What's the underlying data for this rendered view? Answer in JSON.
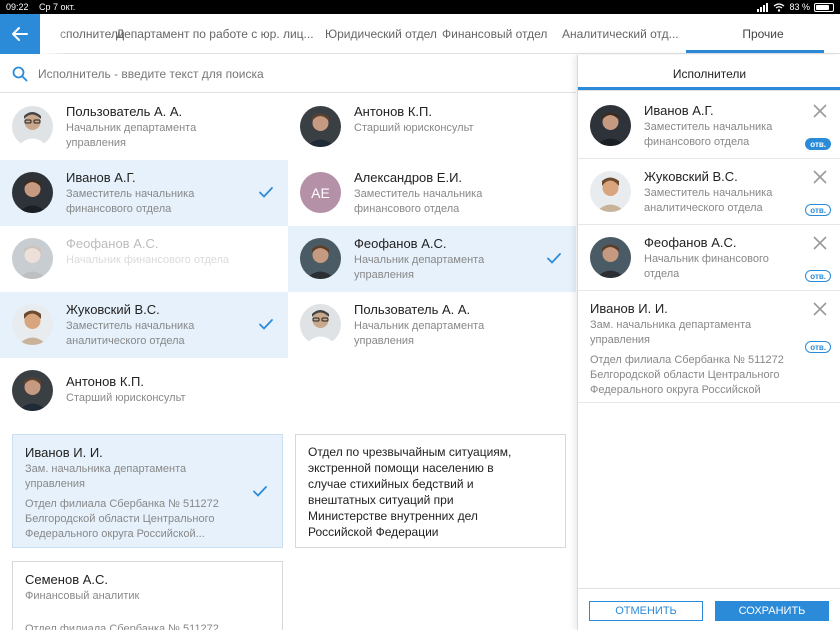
{
  "status_bar": {
    "time": "09:22",
    "date": "Ср 7 окт.",
    "battery": "83 %",
    "battery_level": 0.83
  },
  "tabs": {
    "items": [
      "сполнители",
      "Департамент по работе с юр. лиц...",
      "Юридический отдел",
      "Финансовый отдел",
      "Аналитический отд..."
    ],
    "active": "Прочие"
  },
  "search": {
    "placeholder": "Исполнитель - введите текст для поиска",
    "value": ""
  },
  "people": [
    {
      "name": "Пользователь А. А.",
      "role": "Начальник департамента управления",
      "selected": false,
      "disabled": false
    },
    {
      "name": "Антонов К.П.",
      "role": "Старший юрисконсульт",
      "selected": false,
      "disabled": false
    },
    {
      "name": "Иванов А.Г.",
      "role": "Заместитель начальника финансового отдела",
      "selected": true,
      "disabled": false
    },
    {
      "name": "Александров Е.И.",
      "role": "Заместитель начальника финансового отдела",
      "initials": "АЕ",
      "selected": false,
      "disabled": false
    },
    {
      "name": "Феофанов А.С.",
      "role": "Начальник финансового отдела",
      "selected": false,
      "disabled": true
    },
    {
      "name": "Феофанов А.С.",
      "role": "Начальник департамента управления",
      "selected": true,
      "disabled": false
    },
    {
      "name": "Жуковский В.С.",
      "role": "Заместитель начальника аналитического отдела",
      "selected": true,
      "disabled": false
    },
    {
      "name": "Пользователь А. А.",
      "role": "Начальник департамента управления",
      "selected": false,
      "disabled": false
    },
    {
      "name": "Антонов К.П.",
      "role": "Старший юрисконсульт",
      "selected": false,
      "disabled": false
    }
  ],
  "boxes": [
    {
      "name": "Иванов И. И.",
      "role": "Зам. начальника департамента управления",
      "org": "Отдел филиала Сбербанка № 511272 Белгородской области Центрального Федерального округа Российской...",
      "selected": true
    },
    {
      "text": "Отдел по чрезвычайным ситуациям, экстренной помощи населению в случае стихийных бедствий и внештатных ситуаций при Министерстве внутренних дел Российской Федерации"
    },
    {
      "name": "Семенов А.С.",
      "role": "Финансовый аналитик",
      "org": "Отдел филиала Сбербанка № 511272",
      "selected": false
    }
  ],
  "panel": {
    "title": "Исполнители",
    "items": [
      {
        "name": "Иванов А.Г.",
        "role": "Заместитель начальника финансового отдела",
        "badge": "отв.",
        "badge_filled": true
      },
      {
        "name": "Жуковский В.С.",
        "role": "Заместитель начальника аналитического отдела",
        "badge": "отв.",
        "badge_filled": false
      },
      {
        "name": "Феофанов А.С.",
        "role": "Начальник финансового отдела",
        "badge": "отв.",
        "badge_filled": false
      }
    ],
    "big_item": {
      "name": "Иванов И. И.",
      "role": "Зам. начальника департамента управления",
      "org": "Отдел филиала Сбербанка № 511272 Белгородской области Центрального Федерального округа Российской",
      "badge": "отв."
    },
    "cancel_label": "ОТМЕНИТЬ",
    "save_label": "СОХРАНИТЬ"
  },
  "colors": {
    "accent": "#2b8bd9",
    "selected_bg": "#e6f1fb",
    "avatar_initials_bg": "#b591a8"
  }
}
